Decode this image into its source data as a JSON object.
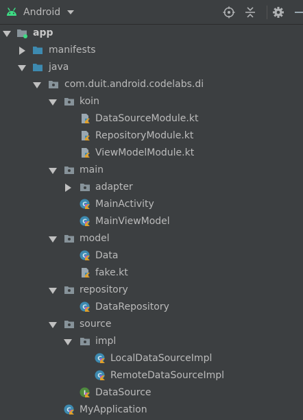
{
  "toolbar": {
    "view_label": "Android",
    "icons": [
      "android-icon",
      "chevron-down-icon",
      "locate-icon",
      "collapse-all-icon",
      "gear-icon",
      "minimize-icon"
    ]
  },
  "tree": [
    {
      "name": "app",
      "icon": "module-folder",
      "expanded": true,
      "bold": true
    },
    {
      "name": "manifests",
      "icon": "folder",
      "expanded": false
    },
    {
      "name": "java",
      "icon": "folder",
      "expanded": true
    },
    {
      "name": "com.duit.android.codelabs.di",
      "icon": "package",
      "expanded": true
    },
    {
      "name": "koin",
      "icon": "package",
      "expanded": true
    },
    {
      "name": "DataSourceModule.kt",
      "icon": "kotlin-file"
    },
    {
      "name": "RepositoryModule.kt",
      "icon": "kotlin-file"
    },
    {
      "name": "ViewModelModule.kt",
      "icon": "kotlin-file"
    },
    {
      "name": "main",
      "icon": "package",
      "expanded": true
    },
    {
      "name": "adapter",
      "icon": "package",
      "expanded": false
    },
    {
      "name": "MainActivity",
      "icon": "kotlin-class"
    },
    {
      "name": "MainViewModel",
      "icon": "kotlin-class"
    },
    {
      "name": "model",
      "icon": "package",
      "expanded": true
    },
    {
      "name": "Data",
      "icon": "kotlin-class"
    },
    {
      "name": "fake.kt",
      "icon": "kotlin-file"
    },
    {
      "name": "repository",
      "icon": "package",
      "expanded": true
    },
    {
      "name": "DataRepository",
      "icon": "kotlin-class"
    },
    {
      "name": "source",
      "icon": "package",
      "expanded": true
    },
    {
      "name": "impl",
      "icon": "package",
      "expanded": true
    },
    {
      "name": "LocalDataSourceImpl",
      "icon": "kotlin-class"
    },
    {
      "name": "RemoteDataSourceImpl",
      "icon": "kotlin-class"
    },
    {
      "name": "DataSource",
      "icon": "kotlin-interface"
    },
    {
      "name": "MyApplication",
      "icon": "kotlin-class"
    }
  ],
  "colors": {
    "background": "#3c3f41",
    "text": "#bbbbbb",
    "folder": "#87939a",
    "class_icon": "#3d8ab0",
    "interface_icon": "#4e8a3e",
    "android_green": "#3ddc84"
  }
}
